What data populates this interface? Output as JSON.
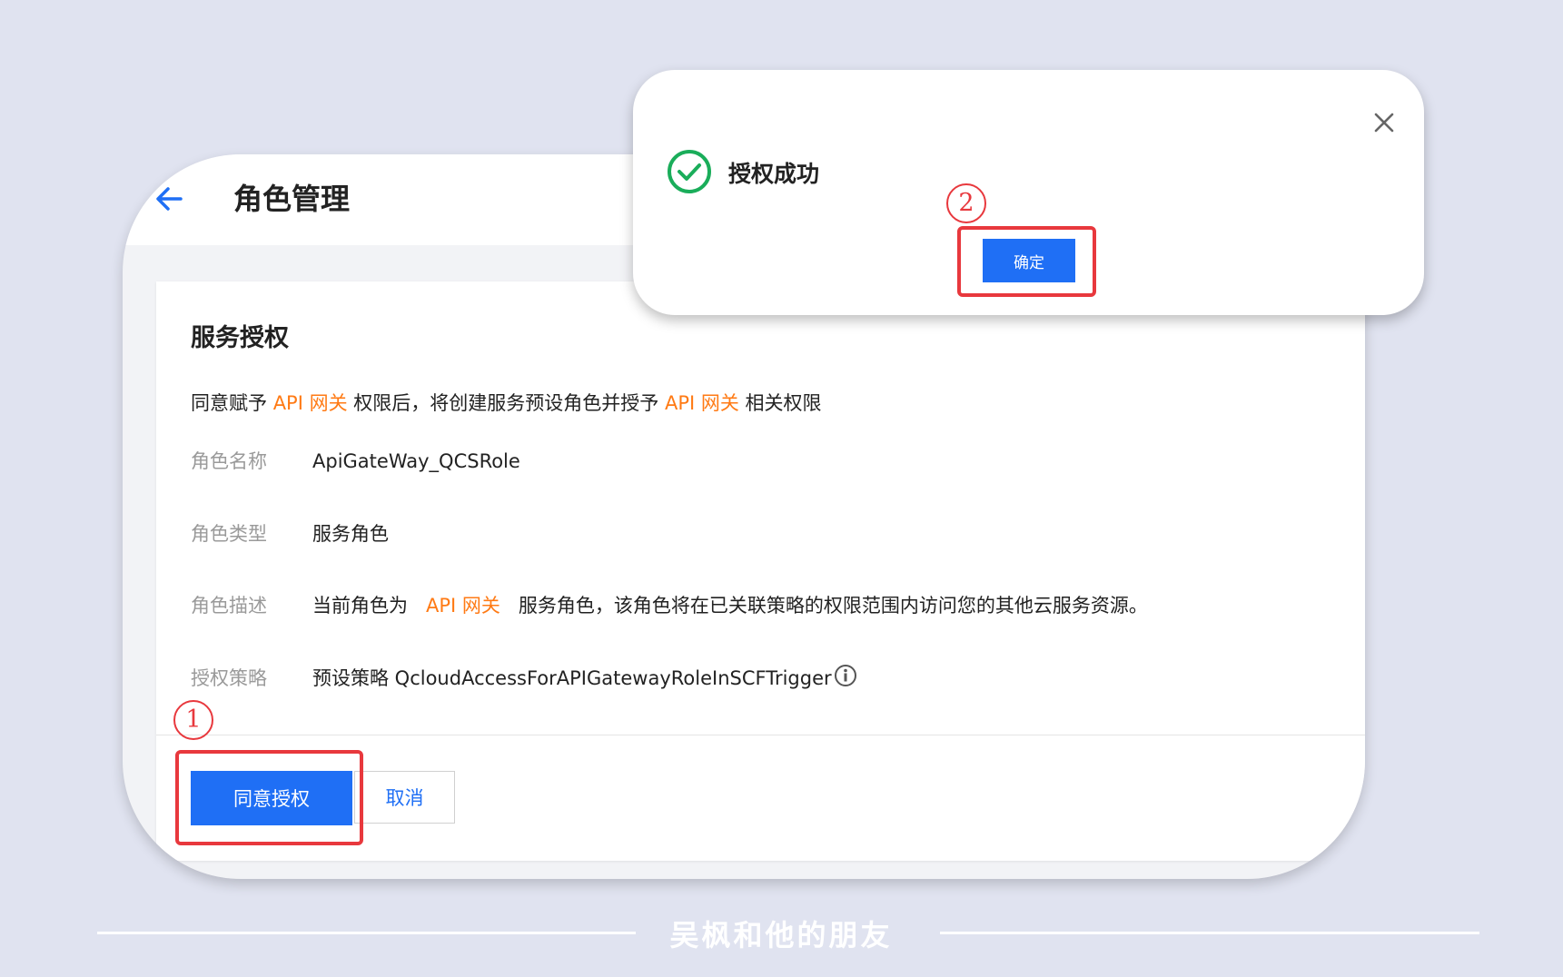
{
  "header": {
    "title": "角色管理"
  },
  "panel": {
    "title": "服务授权",
    "intro": {
      "part1": "同意赋予 ",
      "service1": "API 网关",
      "part2": " 权限后，将创建服务预设角色并授予 ",
      "service2": "API 网关",
      "part3": " 相关权限"
    },
    "fields": {
      "name": {
        "label": "角色名称",
        "value": "ApiGateWay_QCSRole"
      },
      "type": {
        "label": "角色类型",
        "value": "服务角色"
      },
      "desc": {
        "label": "角色描述",
        "prefix": "当前角色为",
        "service": "API 网关",
        "suffix": "服务角色，该角色将在已关联策略的权限范围内访问您的其他云服务资源。"
      },
      "policy": {
        "label": "授权策略",
        "value": "预设策略 QcloudAccessForAPIGatewayRoleInSCFTrigger"
      }
    },
    "buttons": {
      "agree": "同意授权",
      "cancel": "取消"
    }
  },
  "dialog": {
    "title": "授权成功",
    "confirm": "确定"
  },
  "steps": {
    "one": "1",
    "two": "2"
  },
  "footer": {
    "text": "吴枫和他的朋友"
  },
  "colors": {
    "primary": "#1f6ff5",
    "accent": "#ff7a14",
    "highlight": "#e8383d",
    "success": "#1aad5a"
  }
}
